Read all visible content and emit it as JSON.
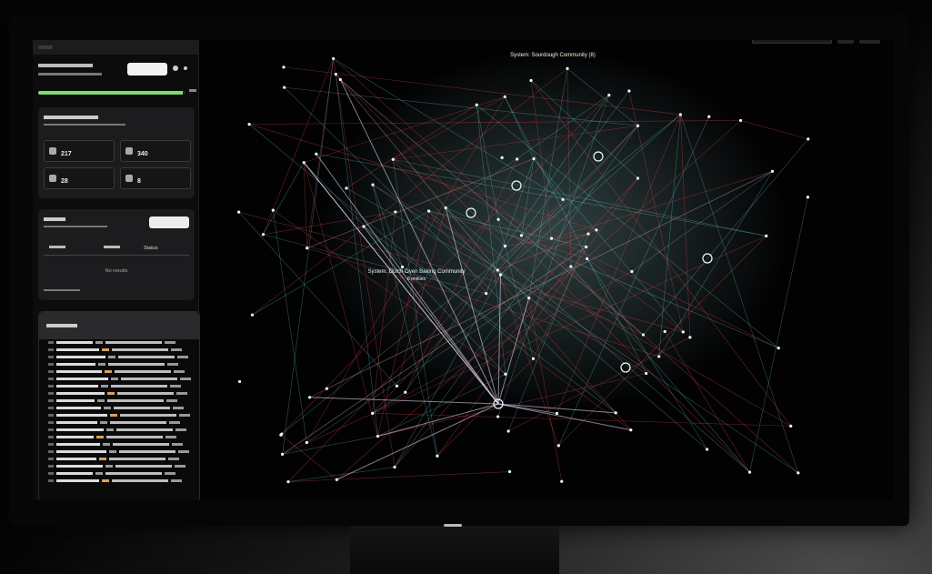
{
  "sidebar": {
    "tabs": [
      "",
      "",
      ""
    ],
    "progress_pct": 0.98,
    "visualization": {
      "stats": [
        {
          "label": "",
          "value": "217"
        },
        {
          "label": "",
          "value": "340"
        },
        {
          "label": "",
          "value": "28"
        },
        {
          "label": "",
          "value": "8"
        }
      ]
    },
    "search": {
      "columns": [
        "",
        "",
        "Status"
      ],
      "no_results": "No results"
    }
  },
  "graph": {
    "community_labels": [
      "System: Sourdough Community (8)",
      "System: Dutch Oven Baking Community",
      "8 entities"
    ]
  },
  "colors": {
    "accent_green": "#7ddc6e",
    "edge_cyan": "#7fe7e7",
    "edge_red": "#e04a4a",
    "background": "#020203"
  }
}
